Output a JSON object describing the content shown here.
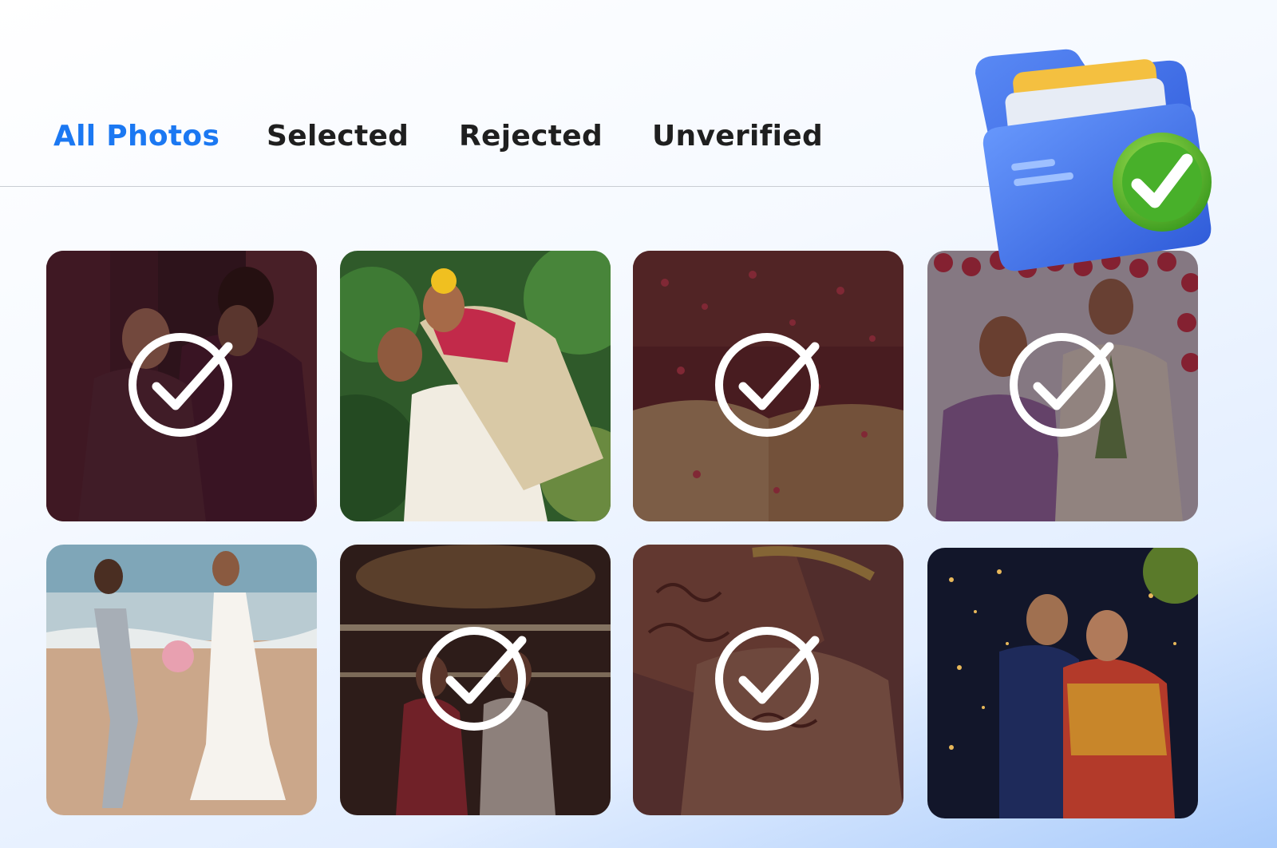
{
  "tabs": [
    {
      "label": "All Photos",
      "active": true
    },
    {
      "label": "Selected",
      "active": false
    },
    {
      "label": "Rejected",
      "active": false
    },
    {
      "label": "Unverified",
      "active": false
    }
  ],
  "colors": {
    "accent": "#1b78f2",
    "tab_text": "#1f1f1f",
    "check": "#ffffff",
    "folder_blue": "#2f63e0",
    "badge_green": "#4caf2c"
  },
  "photos": [
    {
      "subject": "couple-embrace-indoor",
      "selected": true
    },
    {
      "subject": "groom-piggyback-bride-garden",
      "selected": false
    },
    {
      "subject": "petal-shower-ceremony",
      "selected": true
    },
    {
      "subject": "couple-floral-stage",
      "selected": true
    },
    {
      "subject": "beach-wedding-couple",
      "selected": false
    },
    {
      "subject": "couple-banquet-hall",
      "selected": true
    },
    {
      "subject": "henna-hands-closeup",
      "selected": true
    },
    {
      "subject": "couple-night-lights",
      "selected": false
    }
  ],
  "icons": {
    "check": "circle-check-icon",
    "folder": "folder-check-icon"
  }
}
